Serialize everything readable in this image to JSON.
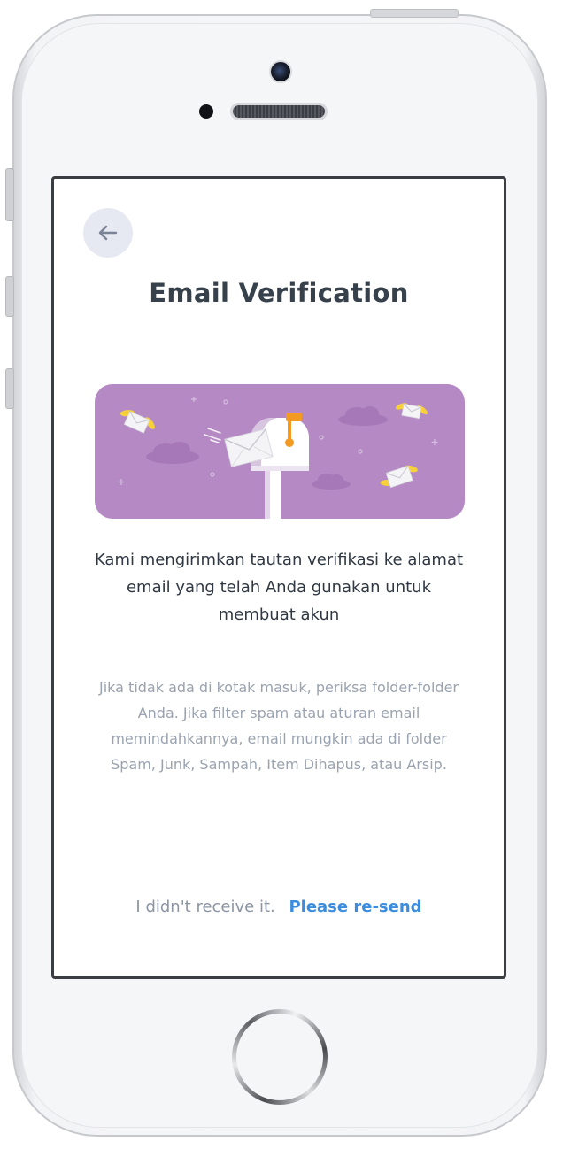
{
  "screen": {
    "title": "Email Verification",
    "primary_message": "Kami mengirimkan tautan verifikasi ke alamat email yang telah Anda gunakan untuk membuat akun",
    "secondary_message": "Jika tidak ada di kotak masuk, periksa folder-folder Anda. Jika filter spam atau aturan email memindahkannya, email mungkin ada di folder Spam, Junk, Sampah, Item Dihapus, atau Arsip.",
    "resend_prompt": "I didn't receive it.",
    "resend_link": "Please re-send"
  },
  "icons": {
    "back": "arrow-left-icon",
    "illustration": "mailbox-illustration"
  },
  "colors": {
    "banner_bg": "#b58ac4",
    "title": "#36414b",
    "link": "#3c8dde",
    "muted_text": "#9aa3af",
    "back_button_bg": "#e6e9f1"
  }
}
